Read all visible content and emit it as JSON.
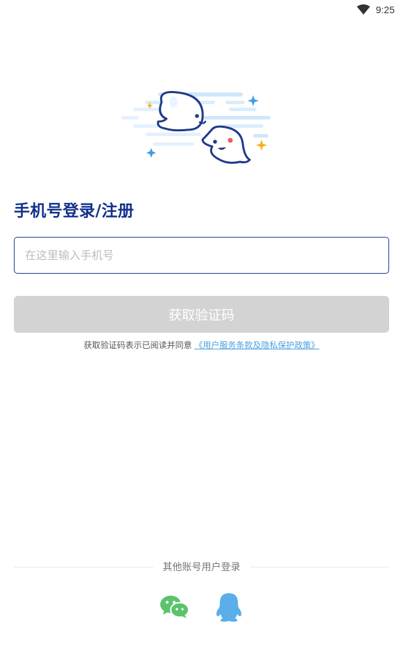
{
  "status_bar": {
    "time": "9:25",
    "wifi_icon": "wifi-icon"
  },
  "hero": {
    "illustration": "ghost-illustration"
  },
  "login": {
    "title": "手机号登录/注册",
    "phone_placeholder": "在这里输入手机号",
    "phone_value": "",
    "get_code_label": "获取验证码",
    "agreement_prefix": "获取验证码表示已阅读并同意",
    "agreement_link": "《用户服务条款及隐私保护政策》"
  },
  "other_login": {
    "divider_label": "其他账号用户登录",
    "options": [
      {
        "name": "wechat",
        "icon": "wechat-icon",
        "color": "#5bc36b"
      },
      {
        "name": "qq",
        "icon": "qq-icon",
        "color": "#5aaeea"
      }
    ]
  },
  "colors": {
    "title": "#12308a",
    "input_border": "#1e3a8a",
    "button_disabled": "#d3d3d3",
    "link": "#4a9fe0"
  }
}
